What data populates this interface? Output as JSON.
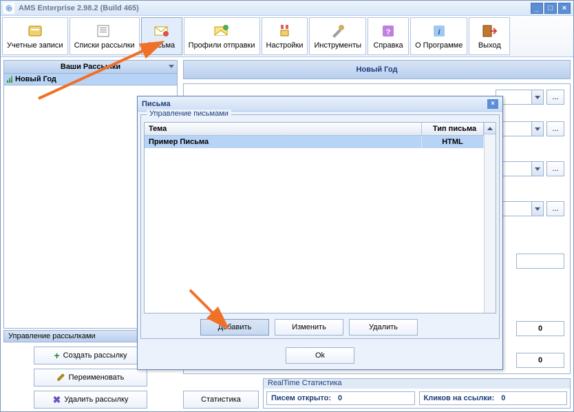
{
  "title": "AMS Enterprise 2.98.2 (Build 465)",
  "toolbar": [
    {
      "label": "Учетные записи",
      "icon": "accounts"
    },
    {
      "label": "Списки рассылки",
      "icon": "lists"
    },
    {
      "label": "Письма",
      "icon": "letters"
    },
    {
      "label": "Профили отправки",
      "icon": "profiles"
    },
    {
      "label": "Настройки",
      "icon": "settings"
    },
    {
      "label": "Инструменты",
      "icon": "tools"
    },
    {
      "label": "Справка",
      "icon": "help"
    },
    {
      "label": "О Программе",
      "icon": "about"
    },
    {
      "label": "Выход",
      "icon": "exit"
    }
  ],
  "left": {
    "header": "Ваши Рассылки",
    "items": [
      "Новый Год"
    ],
    "manage_header": "Управление рассылками",
    "create": "Создать рассылку",
    "rename": "Переименовать",
    "delete": "Удалить рассылку"
  },
  "right": {
    "title": "Новый Год",
    "stats_btn": "Статистика",
    "num1": "0",
    "num2": "0",
    "rt_header": "RealTime Статистика",
    "rt_open_label": "Писем открыто:",
    "rt_open_val": "0",
    "rt_click_label": "Кликов на ссылки:",
    "rt_click_val": "0"
  },
  "dialog": {
    "title": "Письма",
    "group": "Управление письмами",
    "col_subject": "Тема",
    "col_type": "Тип письма",
    "row_subject": "Пример Письма",
    "row_type": "HTML",
    "add": "Добавить",
    "edit": "Изменить",
    "del": "Удалить",
    "ok": "Ok"
  }
}
